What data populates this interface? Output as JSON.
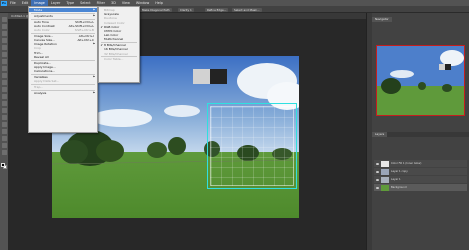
{
  "menubar": {
    "logo": "Ps",
    "items": [
      "File",
      "Edit",
      "Image",
      "Layer",
      "Type",
      "Select",
      "Filter",
      "3D",
      "View",
      "Window",
      "Help"
    ],
    "active_index": 2
  },
  "options": {
    "chips": [
      "Make Diagonal Path",
      "Clarity 1",
      "Refine Edge...",
      "Select and Mask..."
    ]
  },
  "document": {
    "tab_title": "Untitled-1 @ 66.7% (RGB/8) *"
  },
  "panels": {
    "navigator_tab": "Navigator",
    "layers_tab": "Layers"
  },
  "layers": [
    {
      "name": "Color Fill 1 (Inner Glow)"
    },
    {
      "name": "Layer 1 copy"
    },
    {
      "name": "Layer 1"
    },
    {
      "name": "Background"
    }
  ],
  "image_menu": {
    "items": [
      {
        "label": "Mode",
        "arrow": true,
        "highlight": true
      },
      {
        "sep": true
      },
      {
        "label": "Adjustments",
        "arrow": true
      },
      {
        "sep": true
      },
      {
        "label": "Auto Tone",
        "shortcut": "Shift+Ctrl+L"
      },
      {
        "label": "Auto Contrast",
        "shortcut": "Alt+Shift+Ctrl+L"
      },
      {
        "label": "Auto Color",
        "shortcut": "Shift+Ctrl+B",
        "disabled": true
      },
      {
        "sep": true
      },
      {
        "label": "Image Size...",
        "shortcut": "Alt+Ctrl+I"
      },
      {
        "label": "Canvas Size...",
        "shortcut": "Alt+Ctrl+C"
      },
      {
        "label": "Image Rotation",
        "arrow": true
      },
      {
        "label": "Crop",
        "disabled": true
      },
      {
        "label": "Trim..."
      },
      {
        "label": "Reveal All"
      },
      {
        "sep": true
      },
      {
        "label": "Duplicate..."
      },
      {
        "label": "Apply Image..."
      },
      {
        "label": "Calculations..."
      },
      {
        "sep": true
      },
      {
        "label": "Variables",
        "arrow": true
      },
      {
        "label": "Apply Data Set...",
        "disabled": true
      },
      {
        "sep": true
      },
      {
        "label": "Trap...",
        "disabled": true
      },
      {
        "sep": true
      },
      {
        "label": "Analysis",
        "arrow": true
      }
    ]
  },
  "mode_menu": {
    "items": [
      {
        "label": "Bitmap",
        "disabled": true
      },
      {
        "label": "Grayscale"
      },
      {
        "label": "Duotone",
        "disabled": true
      },
      {
        "label": "Indexed Color",
        "disabled": true
      },
      {
        "label": "RGB Color",
        "checked": true
      },
      {
        "label": "CMYK Color"
      },
      {
        "label": "Lab Color"
      },
      {
        "label": "Multichannel"
      },
      {
        "sep": true
      },
      {
        "label": "8 Bits/Channel",
        "checked": true
      },
      {
        "label": "16 Bits/Channel"
      },
      {
        "label": "32 Bits/Channel",
        "disabled": true
      },
      {
        "sep": true
      },
      {
        "label": "Color Table...",
        "disabled": true
      }
    ]
  }
}
